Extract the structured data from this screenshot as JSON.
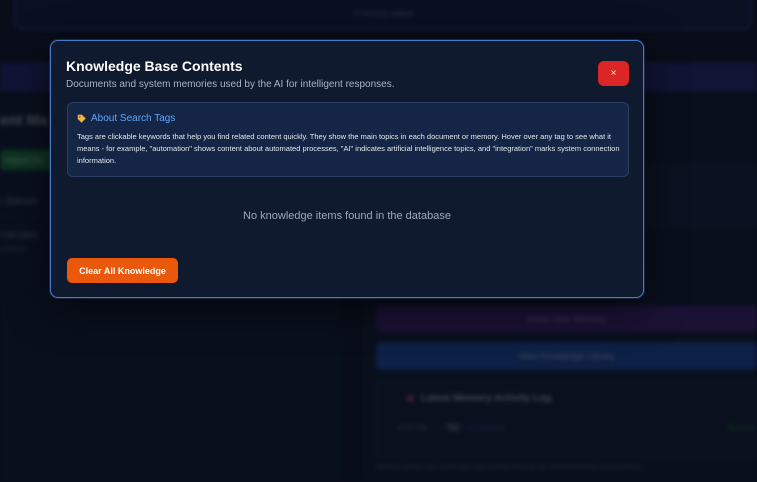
{
  "background": {
    "top_card_text": "3 memory added",
    "left_title": "ent Ma",
    "left_button": "Import Do",
    "left_item_1": "r Docum",
    "left_item_2": "I.txt (doc",
    "left_item_2_sub": "uments",
    "purple_button": "Insert User Memory",
    "blue_button": "View Knowledge Library",
    "log_title": "Latest Memory Activity Log",
    "log_time": "10:00 AM",
    "log_chip": "Tag",
    "log_status": "Unresolved",
    "log_ok": "Success",
    "footer_text": "Memory entries are saved with high priority and can be retrieved during conversations."
  },
  "modal": {
    "title": "Knowledge Base Contents",
    "subtitle": "Documents and system memories used by the AI for intelligent responses.",
    "close_label": "×",
    "info": {
      "icon": "tag-icon",
      "title": "About Search Tags",
      "text": "Tags are clickable keywords that help you find related content quickly. They show the main topics in each document or memory. Hover over any tag to see what it means - for example, \"automation\" shows content about automated processes, \"AI\" indicates artificial intelligence topics, and \"integration\" marks system connection information."
    },
    "empty_message": "No knowledge items found in the database",
    "clear_button": "Clear All Knowledge"
  },
  "colors": {
    "accent_border": "#4a78c8",
    "close_red": "#dc2626",
    "clear_orange": "#ea580c",
    "info_title_blue": "#60a5fa"
  }
}
